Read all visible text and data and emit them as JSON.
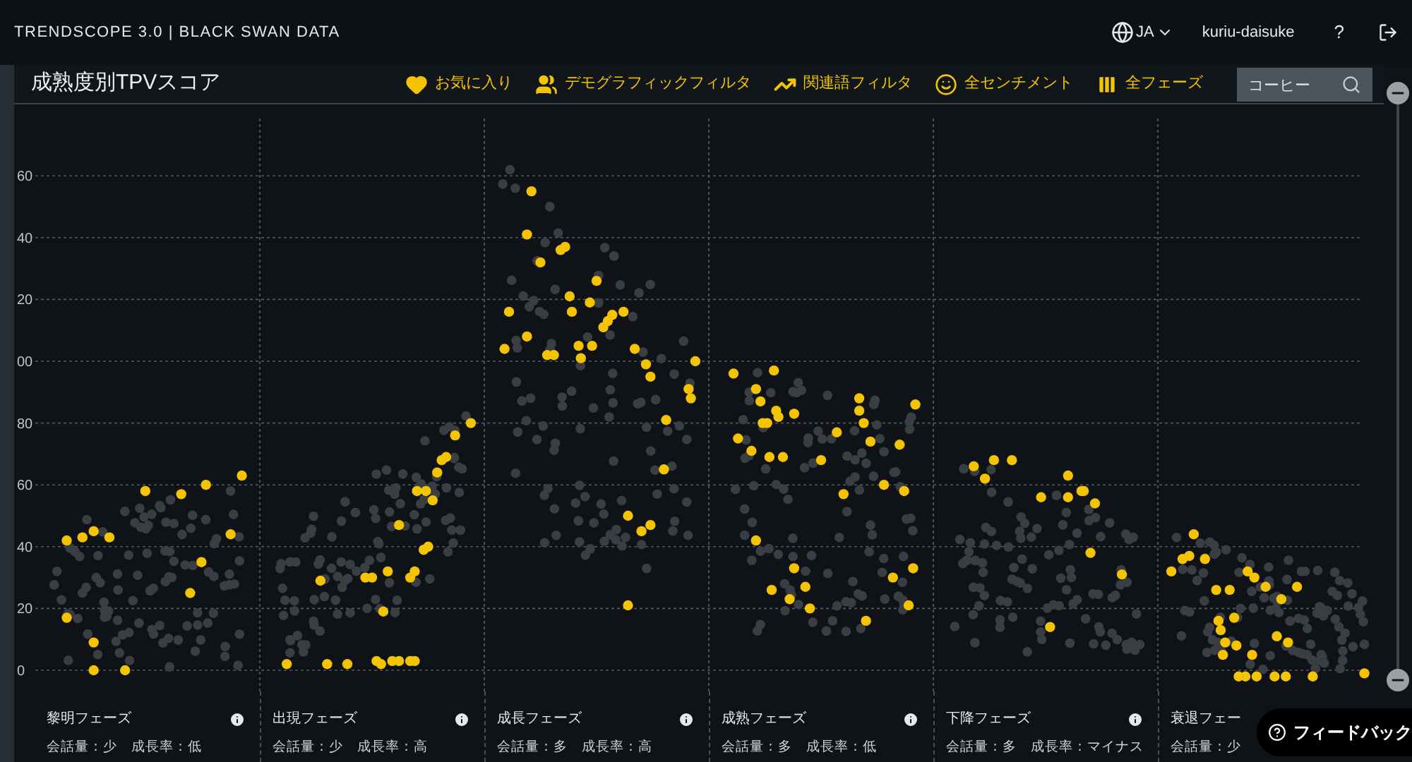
{
  "header": {
    "brand": "TRENDSCOPE 3.0 | BLACK SWAN DATA",
    "language": "JA",
    "user": "kuriu-daisuke",
    "help": "?"
  },
  "toolbar": {
    "title": "成熟度別TPVスコア",
    "filters": [
      {
        "kind": "heart",
        "label": "お気に入り"
      },
      {
        "kind": "people",
        "label": "デモグラフィックフィルタ"
      },
      {
        "kind": "trend",
        "label": "関連語フィルタ"
      },
      {
        "kind": "smile",
        "label": "全センチメント"
      },
      {
        "kind": "columns",
        "label": "全フェーズ"
      }
    ],
    "search": {
      "value": "コーヒー"
    }
  },
  "chart": {
    "y_axis_labels": [
      "60",
      "40",
      "20",
      "00",
      "80",
      "60",
      "40",
      "20",
      "0"
    ]
  },
  "phases": [
    {
      "name": "黎明フェーズ",
      "description": "会話量：少　成長率：低"
    },
    {
      "name": "出現フェーズ",
      "description": "会話量：少　成長率：高"
    },
    {
      "name": "成長フェーズ",
      "description": "会話量：多　成長率：高"
    },
    {
      "name": "成熟フェーズ",
      "description": "会話量：多　成長率：低"
    },
    {
      "name": "下降フェーズ",
      "description": "会話量：多　成長率：マイナス"
    },
    {
      "name": "衰退フェー",
      "description": "会話量：少"
    }
  ],
  "feedback": {
    "label": "フィードバック"
  }
}
